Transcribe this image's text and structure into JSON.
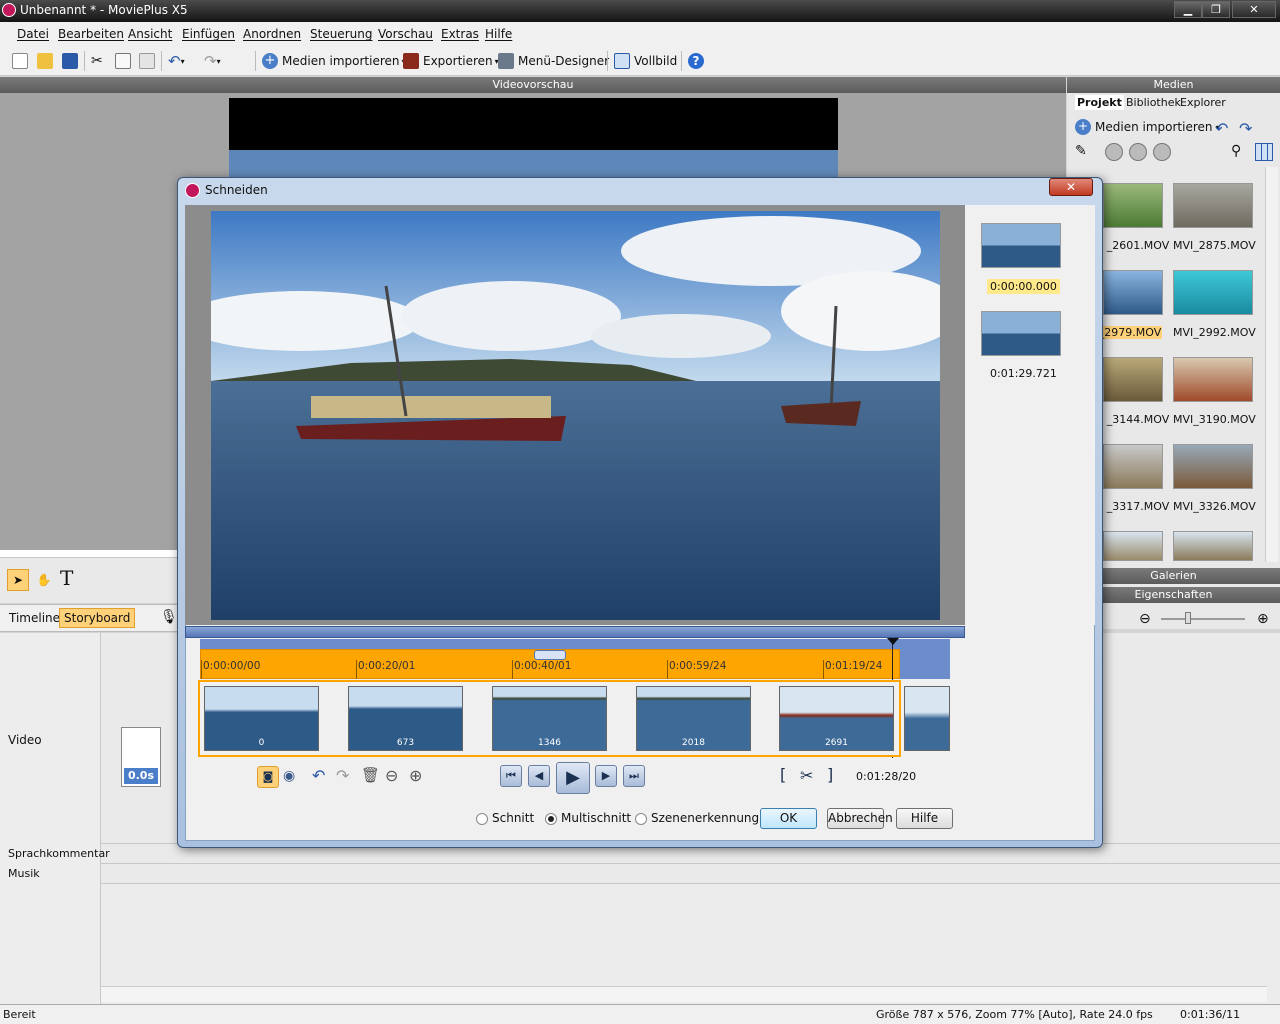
{
  "window": {
    "title": "Unbenannt * - MoviePlus X5"
  },
  "menu": [
    "Datei",
    "Bearbeiten",
    "Ansicht",
    "Einfügen",
    "Anordnen",
    "Steuerung",
    "Vorschau",
    "Extras",
    "Hilfe"
  ],
  "toolbar": {
    "import_label": "Medien importieren",
    "export_label": "Exportieren",
    "menu_designer_label": "Menü-Designer",
    "fullscreen_label": "Vollbild"
  },
  "preview": {
    "header": "Videovorschau"
  },
  "media_panel": {
    "header": "Medien",
    "tabs": [
      "Projekt",
      "Bibliothek",
      "Explorer"
    ],
    "import_label": "Medien importieren",
    "clips": [
      "_2601.MOV",
      "MVI_2875.MOV",
      "_2979.MOV",
      "MVI_2992.MOV",
      "_3144.MOV",
      "MVI_3190.MOV",
      "_3317.MOV",
      "MVI_3326.MOV"
    ],
    "galleries": "Galerien",
    "properties": "Eigenschaften"
  },
  "timeline": {
    "tabs": [
      "Timeline",
      "Storyboard"
    ],
    "tracks": [
      "Video",
      "Sprachkommentar",
      "Musik"
    ],
    "clip_duration": "0.0s"
  },
  "dialog": {
    "title": "Schneiden",
    "marker_times": [
      "0:00:00.000",
      "0:01:29.721"
    ],
    "ruler_ticks": [
      "0:00:00/00",
      "0:00:20/01",
      "0:00:40/01",
      "0:00:59/24",
      "0:01:19/24"
    ],
    "frame_numbers": [
      "0",
      "673",
      "1346",
      "2018",
      "2691"
    ],
    "current_time": "0:01:28/20",
    "options": [
      "Schnitt",
      "Multischnitt",
      "Szenenerkennung"
    ],
    "selected_option": "Multischnitt",
    "ok_label": "OK",
    "cancel_label": "Abbrechen",
    "help_label": "Hilfe"
  },
  "status": {
    "left": "Bereit",
    "info": "Größe 787 x 576, Zoom 77% [Auto], Rate 24.0 fps",
    "time": "0:01:36/11"
  },
  "colors": {
    "accent": "#ffa500",
    "titlebar": "#2b2b2b",
    "dialog_frame": "#a9c1df"
  }
}
